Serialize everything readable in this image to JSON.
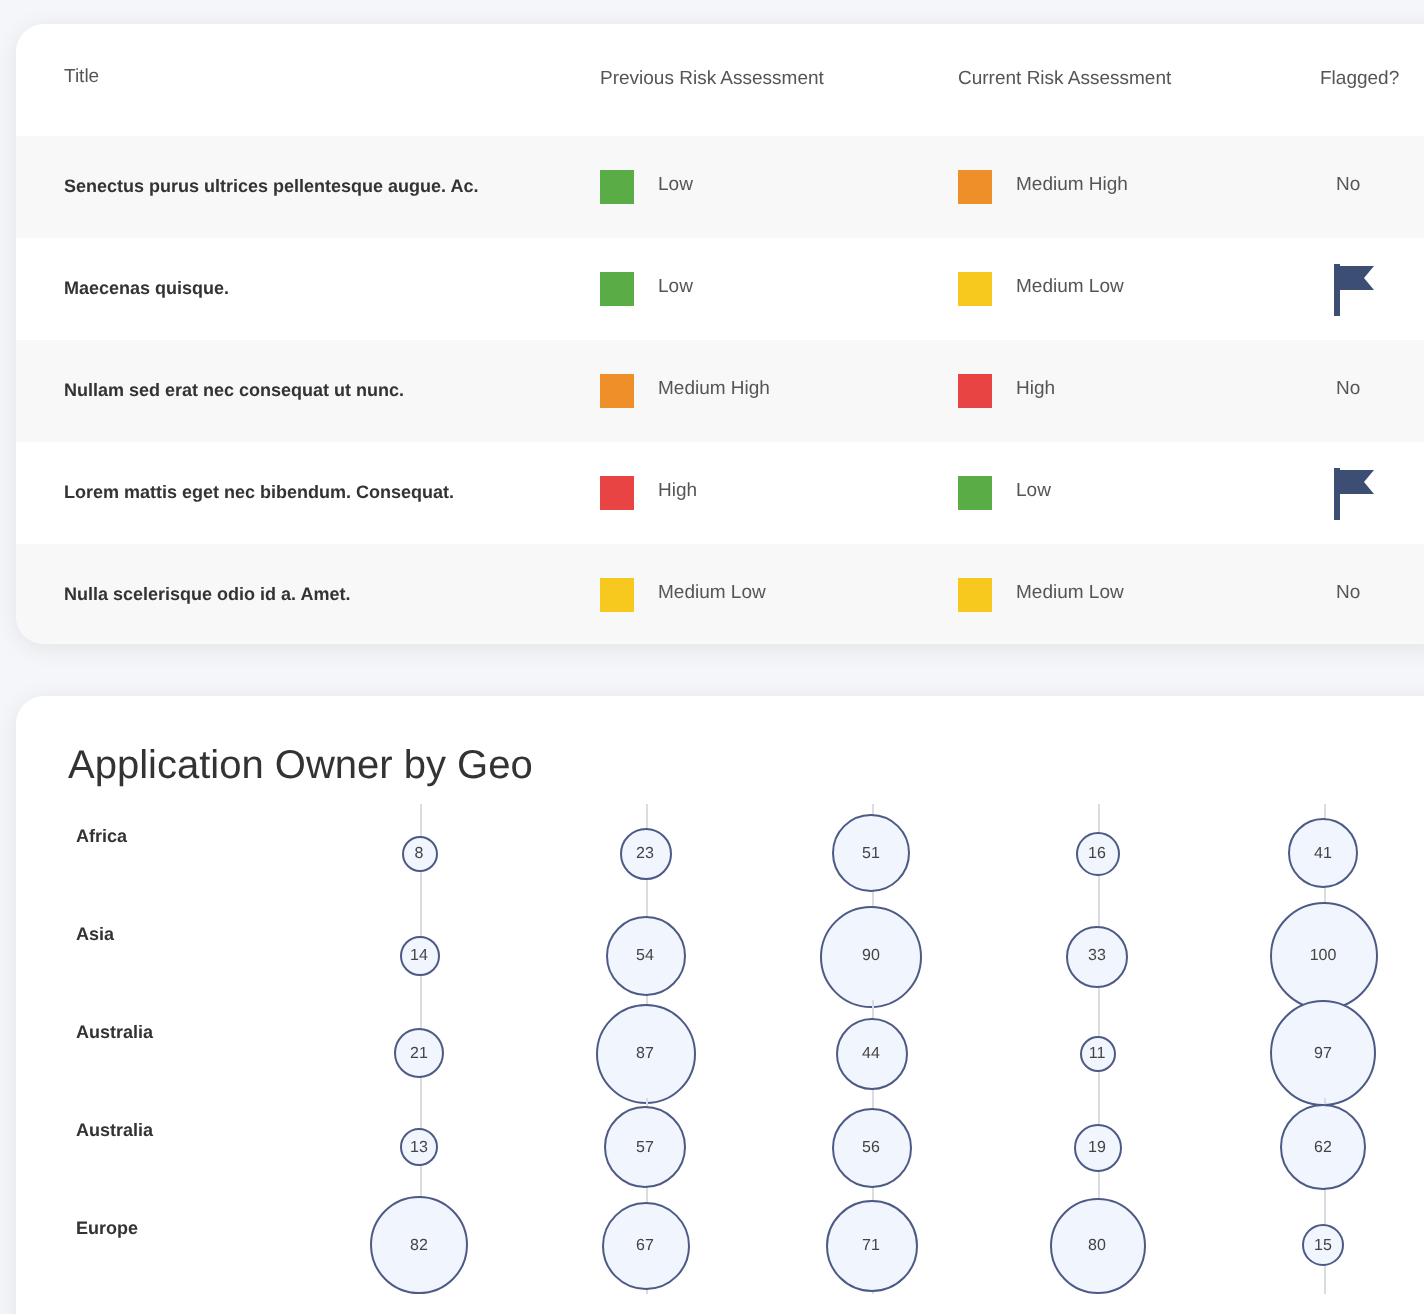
{
  "risk_table": {
    "columns": [
      "Title",
      "Previous Risk Assessment",
      "Current Risk Assessment",
      "Flagged?"
    ],
    "rows": [
      {
        "title": "Senectus purus ultrices pellentesque augue. Ac.",
        "previous": {
          "label": "Low",
          "color": "#5aad46"
        },
        "current": {
          "label": "Medium High",
          "color": "#ef8f2a"
        },
        "flagged": false,
        "flag_text": "No"
      },
      {
        "title": "Maecenas quisque.",
        "previous": {
          "label": "Low",
          "color": "#5aad46"
        },
        "current": {
          "label": "Medium Low",
          "color": "#f7c81e"
        },
        "flagged": true
      },
      {
        "title": "Nullam sed erat nec consequat ut nunc.",
        "previous": {
          "label": "Medium High",
          "color": "#ef8f2a"
        },
        "current": {
          "label": "High",
          "color": "#e84444"
        },
        "flagged": false,
        "flag_text": "No"
      },
      {
        "title": "Lorem mattis eget nec bibendum. Consequat.",
        "previous": {
          "label": "High",
          "color": "#e84444"
        },
        "current": {
          "label": "Low",
          "color": "#5aad46"
        },
        "flagged": true
      },
      {
        "title": "Nulla scelerisque odio id a. Amet.",
        "previous": {
          "label": "Medium Low",
          "color": "#f7c81e"
        },
        "current": {
          "label": "Medium Low",
          "color": "#f7c81e"
        },
        "flagged": false,
        "flag_text": "No"
      }
    ]
  },
  "geo_chart": {
    "title": "Application Owner by Geo",
    "rows": [
      {
        "label": "Africa",
        "values": [
          "8",
          "23",
          "51",
          "16",
          "41"
        ]
      },
      {
        "label": "Asia",
        "values": [
          "14",
          "54",
          "90",
          "33",
          "100"
        ]
      },
      {
        "label": "Australia",
        "values": [
          "21",
          "87",
          "44",
          "11",
          "97"
        ]
      },
      {
        "label": "Australia",
        "values": [
          "13",
          "57",
          "56",
          "19",
          "62"
        ]
      },
      {
        "label": "Europe",
        "values": [
          "82",
          "67",
          "71",
          "80",
          "15"
        ]
      }
    ]
  }
}
